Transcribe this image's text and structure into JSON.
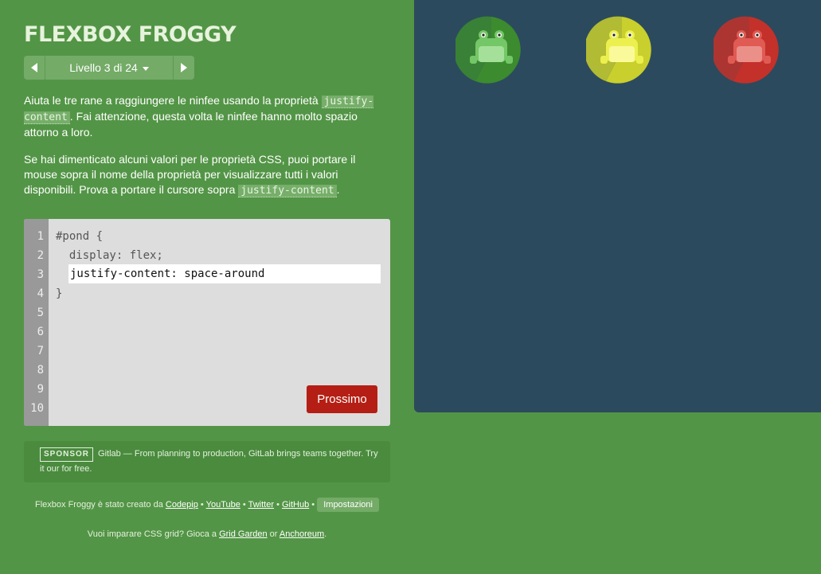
{
  "app": {
    "title": "FLEXBOX FROGGY",
    "level_label": "Livello 3 di 24"
  },
  "instructions": {
    "p1_before": "Aiuta le tre rane a raggiungere le ninfee usando la proprietà ",
    "p1_code": "justify-content",
    "p1_after": ". Fai attenzione, questa volta le ninfee hanno molto spazio attorno a loro.",
    "p2_before": "Se hai dimenticato alcuni valori per le proprietà CSS, puoi portare il mouse sopra il nome della proprietà per visualizzare tutti i valori disponibili. Prova a portare il cursore sopra ",
    "p2_code": "justify-content",
    "p2_after": "."
  },
  "editor": {
    "line_numbers": [
      "1",
      "2",
      "3",
      "4",
      "5",
      "6",
      "7",
      "8",
      "9",
      "10"
    ],
    "line1": "#pond {",
    "line2": "  display: flex;",
    "input_value": "justify-content: space-around",
    "line4": "}",
    "next_label": "Prossimo"
  },
  "sponsor": {
    "badge": "SPONSOR",
    "text": "Gitlab — From planning to production, GitLab brings teams together. Try it our for free."
  },
  "credits": {
    "prefix": "Flexbox Froggy è stato creato da ",
    "codepip": "Codepip",
    "youtube": "YouTube",
    "twitter": "Twitter",
    "github": "GitHub",
    "sep": " • ",
    "settings": "Impostazioni"
  },
  "learn": {
    "prefix": "Vuoi imparare CSS grid? Gioca a ",
    "grid_garden": "Grid Garden",
    "or": " or ",
    "anchoreum": "Anchoreum",
    "suffix": "."
  },
  "pond": {
    "lilypads": [
      {
        "color": "green",
        "pad": "#3c8b2f",
        "frog": "#74c766"
      },
      {
        "color": "yellow",
        "pad": "#c9cf2c",
        "frog": "#f5f57a"
      },
      {
        "color": "red",
        "pad": "#c3312a",
        "frog": "#e8766f"
      }
    ]
  },
  "colors": {
    "background": "#539546",
    "pond": "#2c4a5d",
    "next_button": "#b51e14"
  }
}
